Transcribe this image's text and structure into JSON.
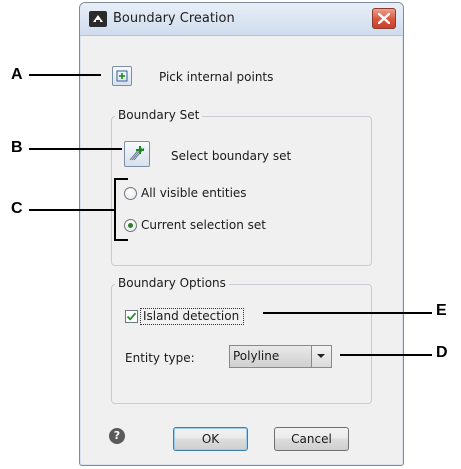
{
  "dialog": {
    "title": "Boundary Creation",
    "pick_internal_points": "Pick internal points",
    "boundary_set": {
      "title": "Boundary Set",
      "select_boundary_set": "Select boundary set",
      "radio_all_visible": "All visible entities",
      "radio_current_selection": "Current selection set",
      "selected_radio": "Current selection set"
    },
    "boundary_options": {
      "title": "Boundary Options",
      "island_detection": "Island detection",
      "island_detection_checked": true,
      "entity_type_label": "Entity type:",
      "entity_type_value": "Polyline"
    },
    "ok_label": "OK",
    "cancel_label": "Cancel"
  },
  "callouts": {
    "a": "A",
    "b": "B",
    "c": "C",
    "d": "D",
    "e": "E"
  }
}
